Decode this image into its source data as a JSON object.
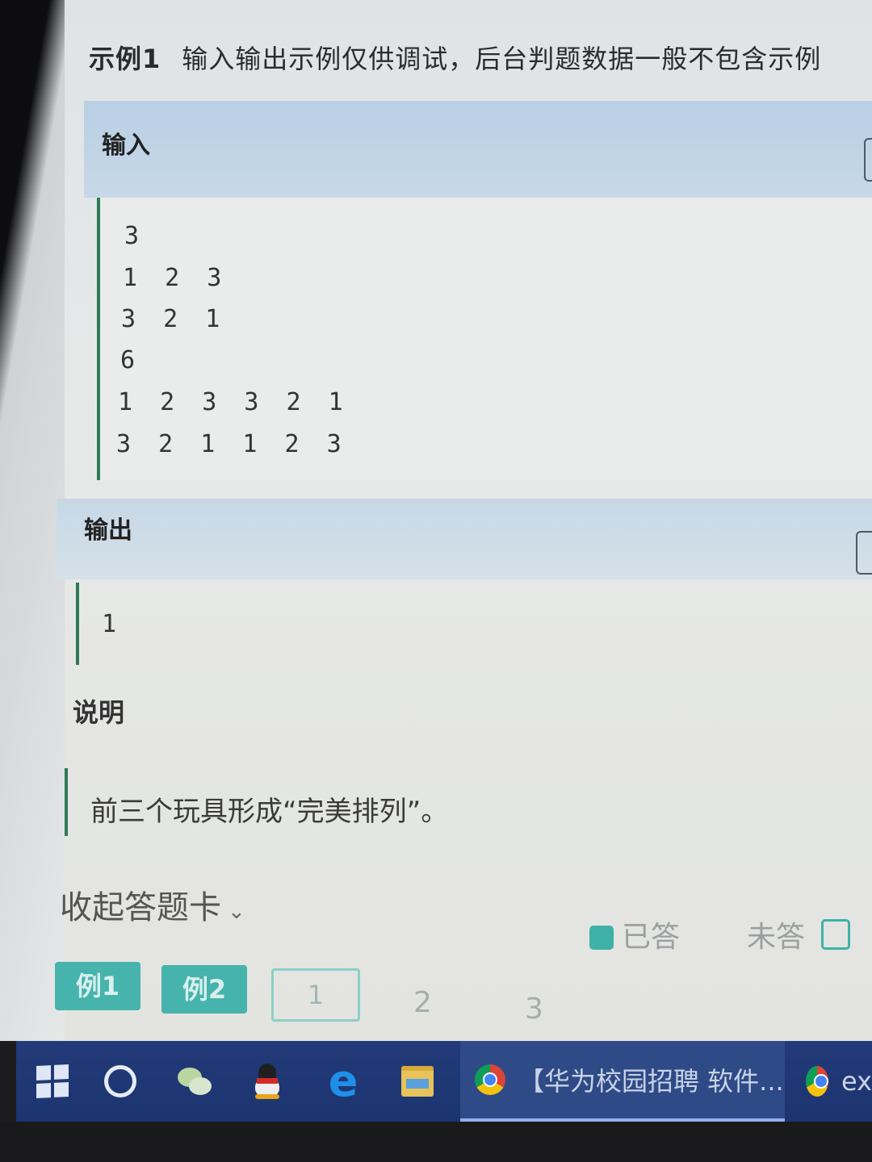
{
  "example": {
    "tag": "示例1",
    "note": "输入输出示例仅供调试，后台判题数据一般不包含示例"
  },
  "input": {
    "label": "输入",
    "lines": [
      "3",
      "1 2 3",
      "3 2 1",
      "6",
      "1 2 3 3 2 1",
      "3 2 1 1 2 3"
    ]
  },
  "output": {
    "label": "输出",
    "lines": [
      "1"
    ]
  },
  "description": {
    "label": "说明",
    "text": "前三个玩具形成“完美排列”。"
  },
  "answer_card": {
    "collapse_label": "收起答题卡",
    "legend_answered": "已答",
    "legend_unanswered": "未答",
    "example_buttons": [
      "例1",
      "例2"
    ],
    "questions": [
      "1",
      "2",
      "3"
    ]
  },
  "taskbar": {
    "active_task": "【华为校园招聘 软件...",
    "second_task": "ex"
  }
}
